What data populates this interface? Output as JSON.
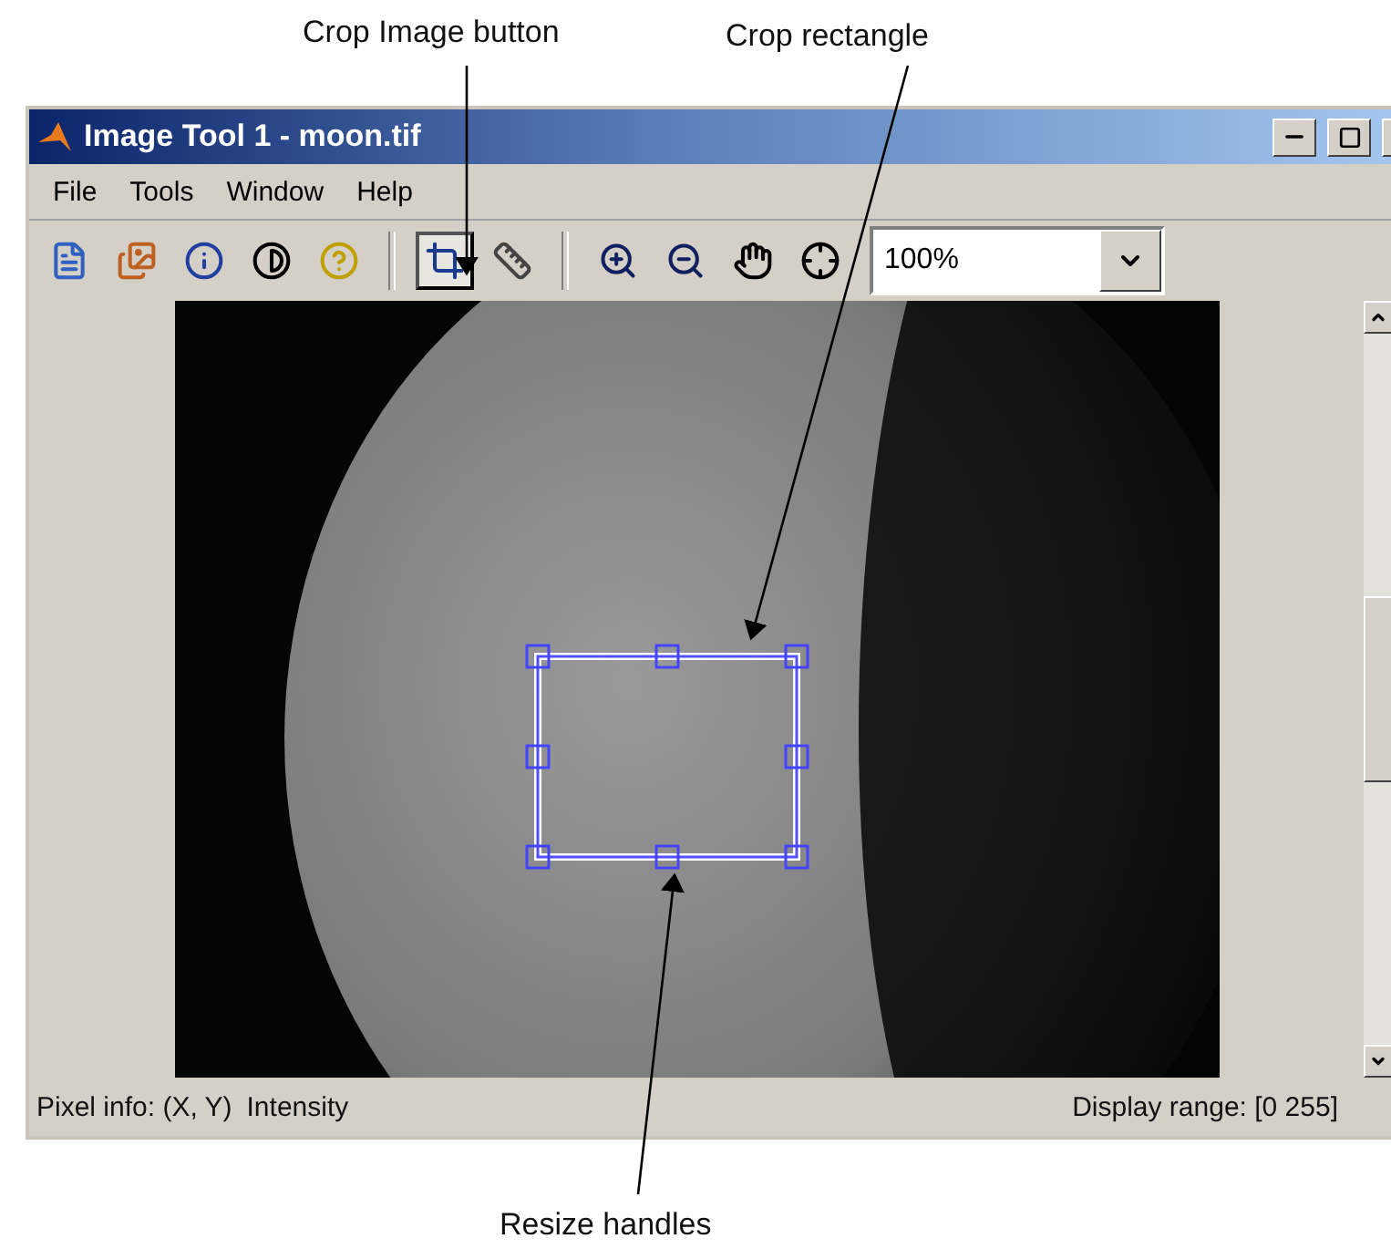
{
  "annotations": [
    {
      "kind": "top",
      "text": "Crop Image button"
    },
    {
      "kind": "top",
      "text": "Crop rectangle"
    },
    {
      "kind": "bottom",
      "text": "Resize handles"
    }
  ],
  "window": {
    "title": "Image Tool 1 - moon.tif"
  },
  "menu": [
    "File",
    "Tools",
    "Window",
    "Help"
  ],
  "toolbar": [
    {
      "kind": "new",
      "selected": false
    },
    {
      "kind": "export",
      "selected": false
    },
    {
      "kind": "info",
      "selected": false
    },
    {
      "kind": "contrast",
      "selected": false
    },
    {
      "kind": "help",
      "selected": false
    },
    {
      "kind": "sep"
    },
    {
      "kind": "crop",
      "selected": true
    },
    {
      "kind": "ruler",
      "selected": false
    },
    {
      "kind": "sep"
    },
    {
      "kind": "zoomin",
      "selected": false
    },
    {
      "kind": "zoomout",
      "selected": false
    },
    {
      "kind": "pan",
      "selected": false
    },
    {
      "kind": "pixel",
      "selected": false
    }
  ],
  "zoom": {
    "value": "100%"
  },
  "status_bar": {
    "pixel_info": "Pixel info: (X, Y)",
    "value": "Intensity",
    "display_range": "Display range: [0 255]"
  }
}
